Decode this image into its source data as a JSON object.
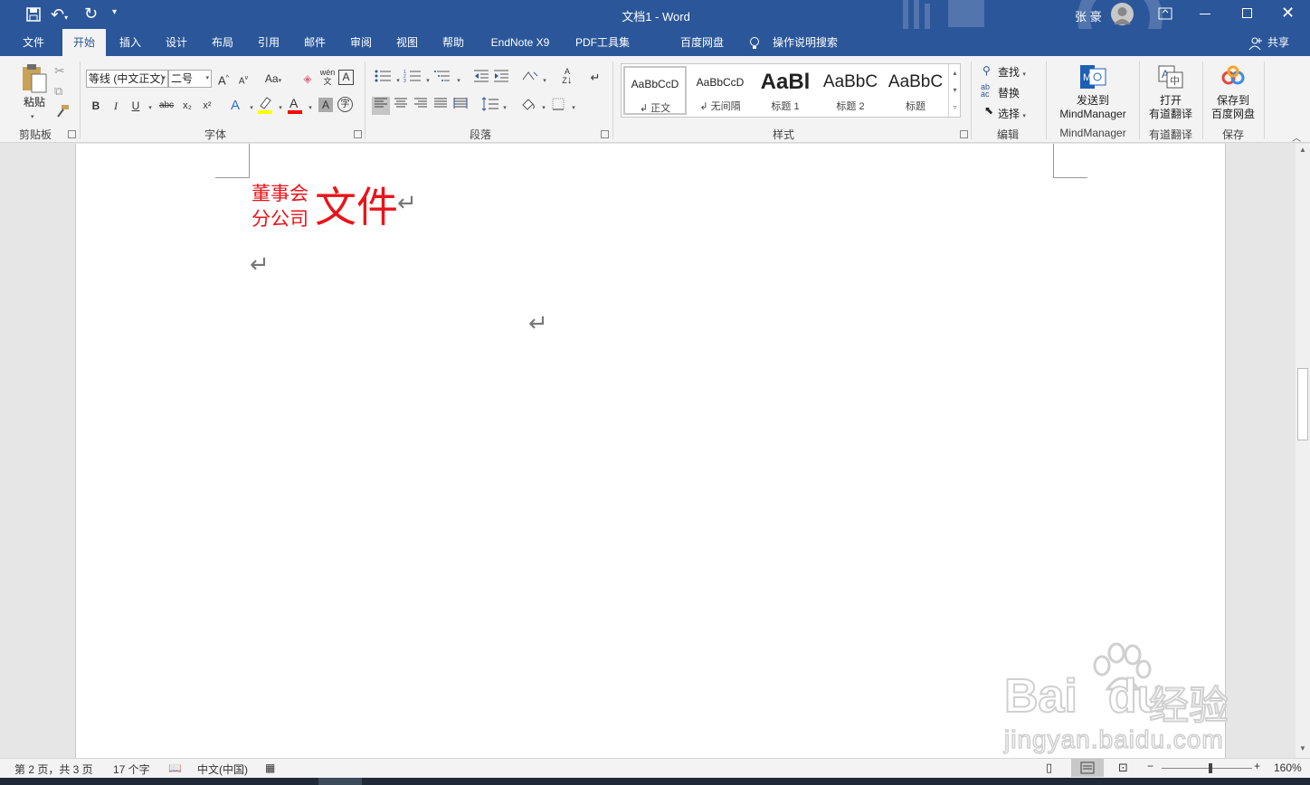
{
  "title": {
    "doc": "文档1",
    "sep": " - ",
    "app": "Word",
    "user": "张 豪"
  },
  "tabs": [
    "文件",
    "开始",
    "插入",
    "设计",
    "布局",
    "引用",
    "邮件",
    "审阅",
    "视图",
    "帮助",
    "EndNote X9",
    "PDF工具集",
    "百度网盘"
  ],
  "tell_me": "操作说明搜索",
  "share": "共享",
  "clipboard": {
    "paste": "粘贴",
    "label": "剪贴板"
  },
  "font": {
    "name": "等线 (中文正文)",
    "size": "二号",
    "label": "字体",
    "grow": "A",
    "shrink": "A",
    "case": "Aa",
    "phonetic": "wén",
    "bold": "B",
    "italic": "I",
    "underline": "U",
    "strike": "abc",
    "sub": "x₂",
    "sup": "x²"
  },
  "paragraph": {
    "label": "段落"
  },
  "styles": {
    "label": "样式",
    "items": [
      {
        "sample": "AaBbCcD",
        "name": "正文"
      },
      {
        "sample": "AaBbCcD",
        "name": "无间隔"
      },
      {
        "sample": "AaBl",
        "name": "标题 1"
      },
      {
        "sample": "AaBbC",
        "name": "标题 2"
      },
      {
        "sample": "AaBbC",
        "name": "标题"
      }
    ]
  },
  "editing": {
    "find": "查找",
    "replace": "替换",
    "select": "选择",
    "label": "编辑"
  },
  "mindmanager": {
    "line1": "发送到",
    "line2": "MindManager",
    "label": "MindManager"
  },
  "youdao": {
    "line1": "打开",
    "line2": "有道翻译",
    "label": "有道翻译"
  },
  "baidu": {
    "line1": "保存到",
    "line2": "百度网盘",
    "label": "保存"
  },
  "document": {
    "combine_top": "董事会",
    "combine_bottom": "分公司",
    "big": "文件",
    "para_mark": "↵",
    "red": "#e8141a"
  },
  "status": {
    "page": "第 2 页，共 3 页",
    "words": "17 个字",
    "lang": "中文(中国)",
    "zoom": "160%"
  },
  "watermark": {
    "brand": "Bai",
    "brand2": "du",
    "cn": "经验",
    "url": "jingyan.baidu.com"
  },
  "colors": {
    "ribbon_blue": "#2b579a",
    "highlight": "#ffff00",
    "font_red": "#ff0000"
  }
}
